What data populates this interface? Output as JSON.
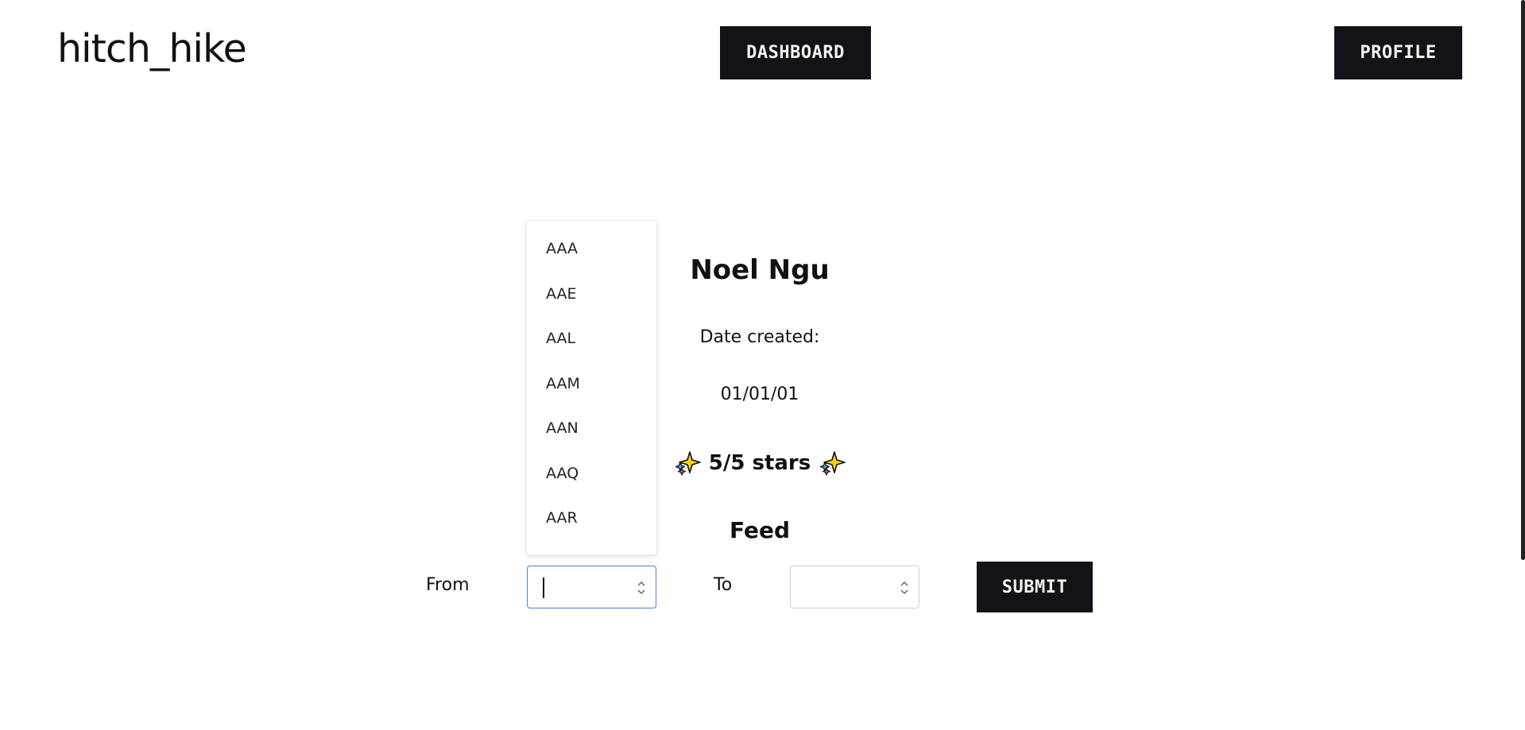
{
  "header": {
    "logo": "hitch_hike",
    "dashboard_label": "DASHBOARD",
    "profile_label": "PROFILE"
  },
  "profile": {
    "name": "Noel Ngu",
    "date_label": "Date created:",
    "date_value": "01/01/01",
    "rating_text": "5/5 stars",
    "rating_icon": "sparkles-icon"
  },
  "feed": {
    "title": "Feed"
  },
  "form": {
    "from_label": "From",
    "to_label": "To",
    "from_value": "",
    "to_value": "",
    "submit_label": "SUBMIT"
  },
  "dropdown": {
    "options": [
      "AAA",
      "AAE",
      "AAL",
      "AAM",
      "AAN",
      "AAQ",
      "AAR"
    ]
  },
  "colors": {
    "button_bg": "#111316",
    "button_text": "#f2f2f2",
    "focus_border": "#3d86d6",
    "sparkle_yellow": "#f7d117"
  }
}
